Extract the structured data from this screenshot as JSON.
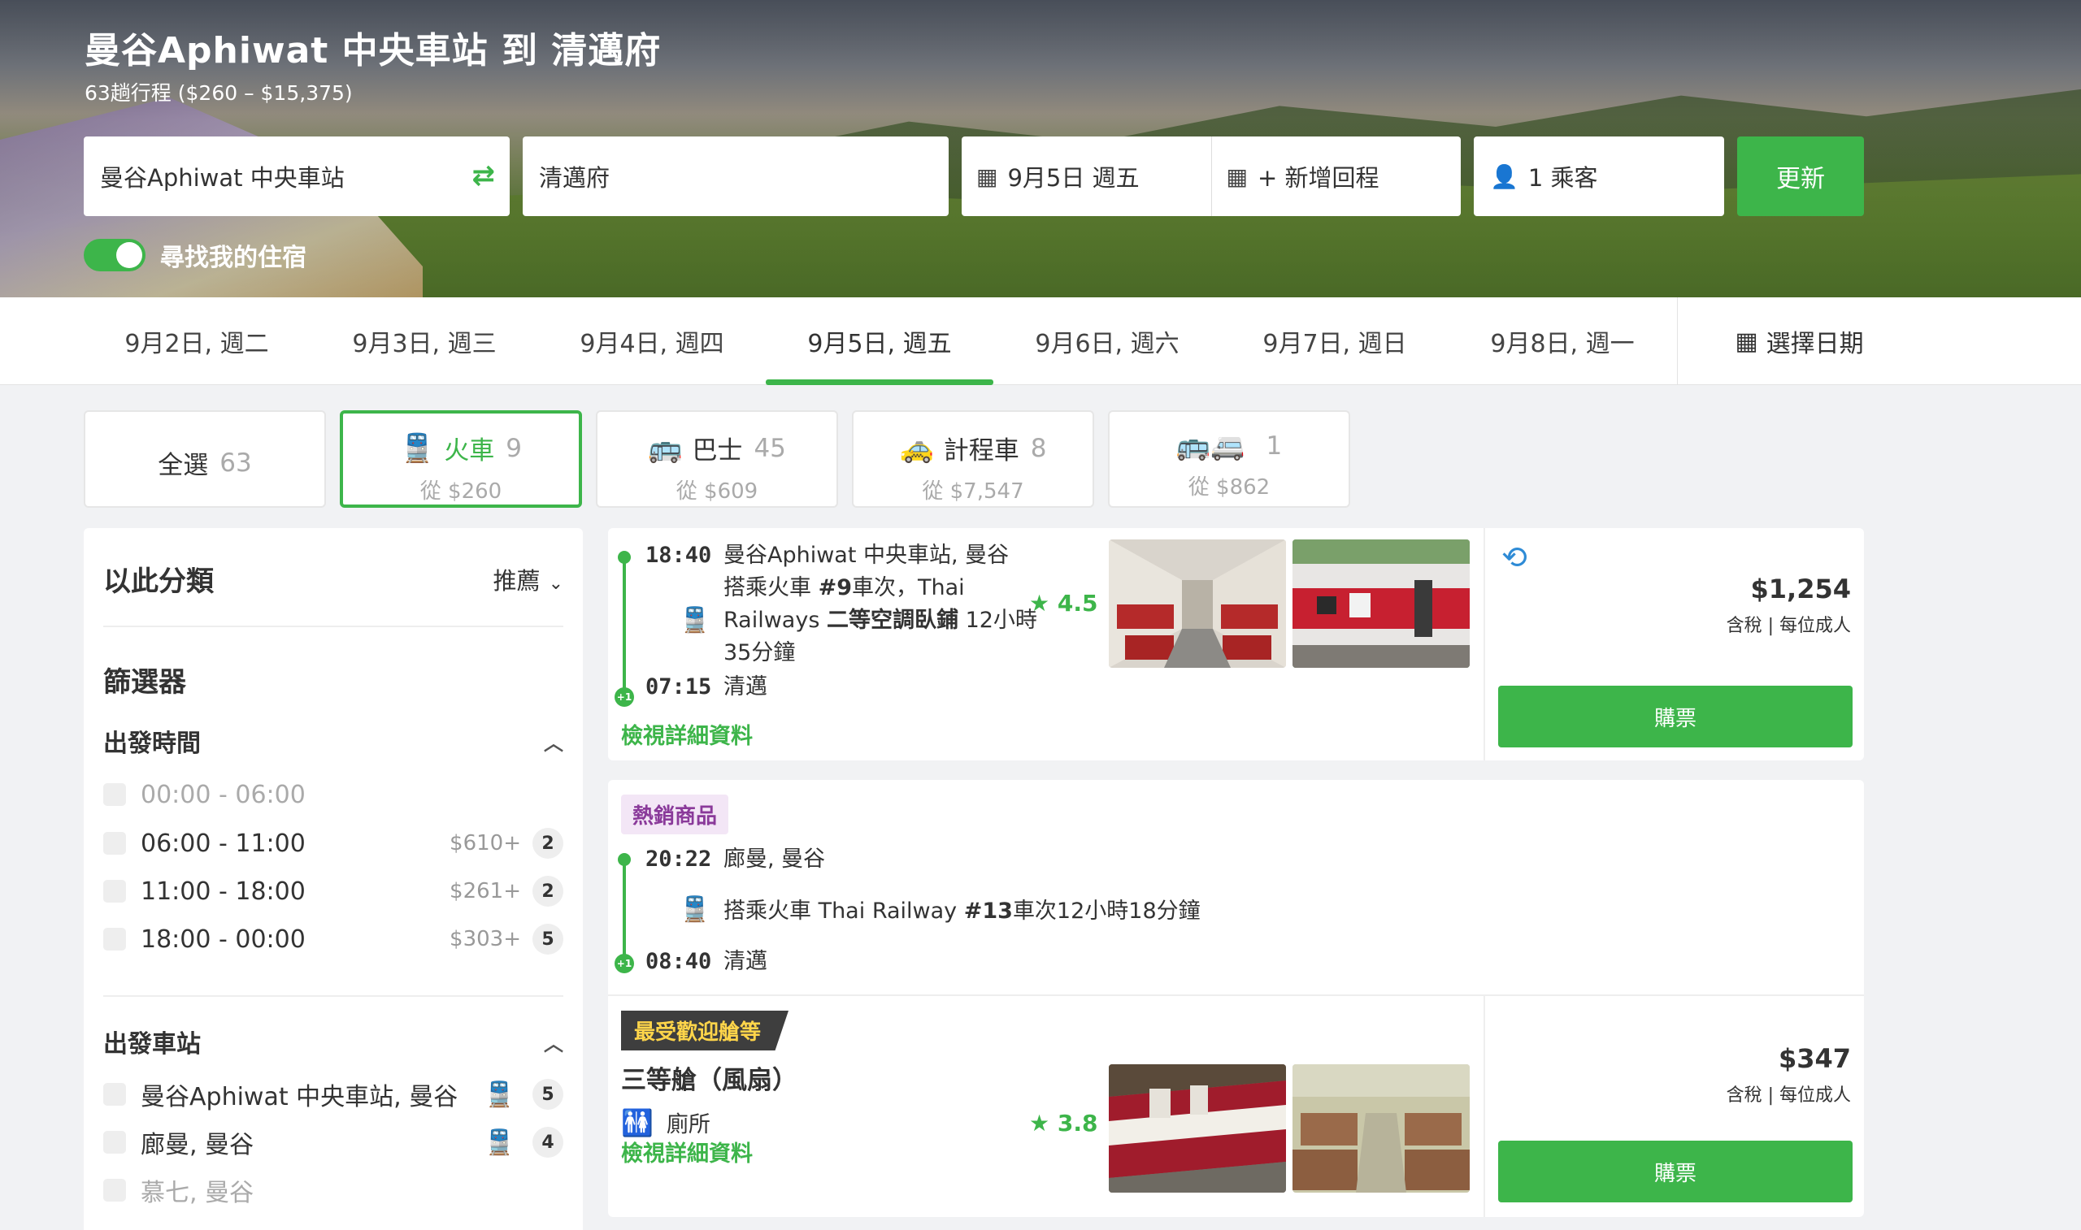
{
  "header": {
    "title": "曼谷Aphiwat 中央車站 到 清邁府",
    "subtitle": "63趟行程 ($260 – $15,375)"
  },
  "search": {
    "from": "曼谷Aphiwat 中央車站",
    "to": "清邁府",
    "depart_date": "9月5日 週五",
    "return_date": "+ 新增回程",
    "passengers": "1 乘客",
    "update_label": "更新",
    "toggle_label": "尋找我的住宿"
  },
  "dates": {
    "tabs": [
      "9月2日, 週二",
      "9月3日, 週三",
      "9月4日, 週四",
      "9月5日, 週五",
      "9月6日, 週六",
      "9月7日, 週日",
      "9月8日, 週一"
    ],
    "active_index": 3,
    "pick_label": "選擇日期"
  },
  "modes": [
    {
      "label": "全選",
      "count": "63",
      "from": ""
    },
    {
      "label": "火車",
      "count": "9",
      "from": "從 $260"
    },
    {
      "label": "巴士",
      "count": "45",
      "from": "從 $609"
    },
    {
      "label": "計程車",
      "count": "8",
      "from": "從 $7,547"
    },
    {
      "label": "",
      "count": "1",
      "from": "從 $862"
    }
  ],
  "sidebar": {
    "sort_label": "以此分類",
    "sort_value": "推薦",
    "filters_title": "篩選器",
    "departure_time": {
      "title": "出發時間",
      "options": [
        {
          "label": "00:00 - 06:00",
          "price": "",
          "count": ""
        },
        {
          "label": "06:00 - 11:00",
          "price": "$610+",
          "count": "2"
        },
        {
          "label": "11:00 - 18:00",
          "price": "$261+",
          "count": "2"
        },
        {
          "label": "18:00 - 00:00",
          "price": "$303+",
          "count": "5"
        }
      ]
    },
    "departure_station": {
      "title": "出發車站",
      "options": [
        {
          "label": "曼谷Aphiwat 中央車站, 曼谷",
          "count": "5"
        },
        {
          "label": "廊曼, 曼谷",
          "count": "4"
        },
        {
          "label": "慕七, 曼谷",
          "count": ""
        }
      ]
    }
  },
  "results": [
    {
      "depart_time": "18:40",
      "depart_station": "曼谷Aphiwat 中央車站, 曼谷",
      "train_line1_pre": "搭乘火車 ",
      "train_line1_bold": "#9",
      "train_line1_post": "車次，Thai",
      "train_line2_pre": "Railways ",
      "train_line2_bold": "二等空調臥鋪",
      "train_line2_post": " 12小時",
      "train_line3": "35分鐘",
      "arrive_time": "07:15",
      "arrive_station": "清邁",
      "rating": "4.5",
      "details_link": "檢視詳細資料",
      "price": "$1,254",
      "price_note": "含稅 | 每位成人",
      "buy_label": "購票"
    },
    {
      "tag": "熱銷商品",
      "depart_time": "20:22",
      "depart_station": "廊曼, 曼谷",
      "train_pre": "搭乘火車 Thai Railway ",
      "train_bold": "#13",
      "train_post": "車次12小時18分鐘",
      "arrive_time": "08:40",
      "arrive_station": "清邁"
    },
    {
      "tag": "最受歡迎艙等",
      "class_name": "三等艙（風扇）",
      "amenity": "廁所",
      "rating": "3.8",
      "details_link": "檢視詳細資料",
      "price": "$347",
      "price_note": "含稅 | 每位成人",
      "buy_label": "購票"
    }
  ],
  "colors": {
    "accent": "#3db54a",
    "tag_hot_bg": "#f3e6f6",
    "tag_pop_bg": "#3e3e3e"
  }
}
